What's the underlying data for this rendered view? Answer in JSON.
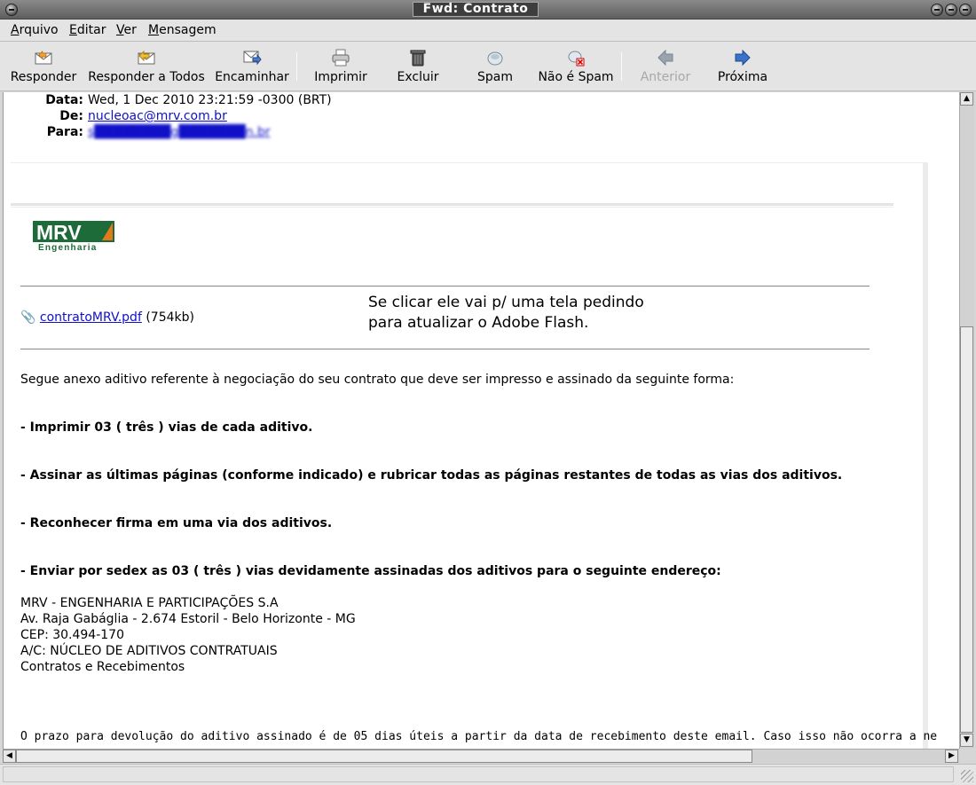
{
  "window": {
    "title": "Fwd: Contrato"
  },
  "menu": [
    "Arquivo",
    "Editar",
    "Ver",
    "Mensagem"
  ],
  "toolbar": {
    "reply": "Responder",
    "reply_all": "Responder a Todos",
    "forward": "Encaminhar",
    "print": "Imprimir",
    "delete": "Excluir",
    "spam": "Spam",
    "not_spam": "Não é Spam",
    "previous": "Anterior",
    "next": "Próxima"
  },
  "headers": {
    "date_label": "Data:",
    "date_value": "Wed, 1 Dec 2010 23:21:59 -0300 (BRT)",
    "from_label": "De:",
    "from_value": "nucleoac@mrv.com.br",
    "to_label": "Para:",
    "to_value": "s████████g███████n.br"
  },
  "logo": {
    "brand": "MRV",
    "sub": "Engenharia"
  },
  "attachment": {
    "name": "contratoMRV.pdf",
    "size": "(754kb)"
  },
  "annotation": {
    "line1": "Se clicar ele vai p/ uma tela pedindo",
    "line2": "para atualizar o Adobe Flash."
  },
  "body": {
    "intro": "Segue anexo aditivo referente à negociação do seu contrato que deve ser impresso e assinado da seguinte forma:",
    "step1": "- Imprimir 03 ( três ) vias de cada aditivo.",
    "step2": "- Assinar as últimas páginas (conforme indicado) e rubricar todas as páginas restantes de todas as vias dos aditivos.",
    "step3": "- Reconhecer firma em uma via dos aditivos.",
    "step4": "- Enviar por sedex as 03 ( três ) vias devidamente assinadas dos aditivos para o seguinte endereço:",
    "address": [
      "MRV - ENGENHARIA E PARTICIPAÇÕES S.A",
      "Av. Raja Gabáglia - 2.674 Estoril - Belo Horizonte - MG",
      "CEP: 30.494-170",
      "A/C: NÚCLEO DE ADITIVOS CONTRATUAIS",
      "Contratos e Recebimentos"
    ],
    "deadline": "O prazo para devolução do aditivo assinado é de 05 dias úteis a partir da data de recebimento deste email. Caso isso não ocorra a ne"
  },
  "colors": {
    "link": "#1010c8",
    "logo_green": "#1e6b3a",
    "logo_orange": "#e07a1c"
  }
}
